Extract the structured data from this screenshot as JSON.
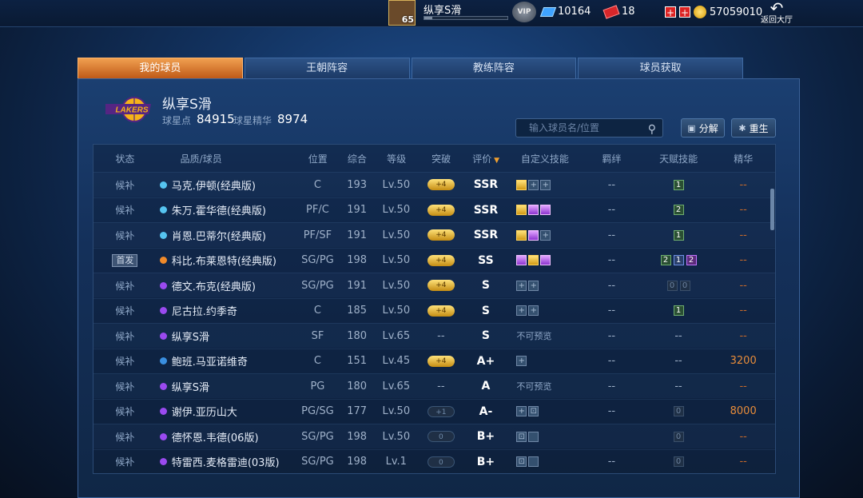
{
  "topbar": {
    "level": "65",
    "username": "纵享S滑",
    "xp_fraction": 0.1,
    "vip_label": "VIP",
    "diamonds": "10164",
    "tickets": "18",
    "coins": "57059010",
    "back_label": "返回大厅"
  },
  "tabs": [
    {
      "label": "我的球员",
      "active": true
    },
    {
      "label": "王朝阵容",
      "active": false
    },
    {
      "label": "教练阵容",
      "active": false
    },
    {
      "label": "球员获取",
      "active": false
    }
  ],
  "team": {
    "name": "纵享S滑",
    "star_points_label": "球星点",
    "star_points": "84915",
    "essence_label": "球星精华",
    "essence": "8974",
    "logo_text": "LAKERS"
  },
  "search": {
    "placeholder": "输入球员名/位置"
  },
  "buttons": {
    "decompose": "分解",
    "rebirth": "重生"
  },
  "columns": [
    "状态",
    "品质/球员",
    "位置",
    "综合",
    "等级",
    "突破",
    "评价",
    "自定义技能",
    "羁绊",
    "天赋技能",
    "精华"
  ],
  "rows": [
    {
      "status": "候补",
      "starter": false,
      "dot": "#56c4f0",
      "name": "马克.伊顿(经典版)",
      "pos": "C",
      "ovr": "193",
      "lvl": "Lv.50",
      "brk": "+4",
      "brk_style": "gold",
      "grade": "SSR",
      "skills": [
        "gold",
        "plus",
        "plus"
      ],
      "skill_text": "",
      "bond": "--",
      "talents": [
        {
          "t": "1",
          "c": ""
        }
      ],
      "ess": "--"
    },
    {
      "status": "候补",
      "starter": false,
      "dot": "#56c4f0",
      "name": "朱万.霍华德(经典版)",
      "pos": "PF/C",
      "ovr": "191",
      "lvl": "Lv.50",
      "brk": "+4",
      "brk_style": "gold",
      "grade": "SSR",
      "skills": [
        "gold",
        "purple",
        "purple"
      ],
      "skill_text": "",
      "bond": "--",
      "talents": [
        {
          "t": "2",
          "c": ""
        }
      ],
      "ess": "--"
    },
    {
      "status": "候补",
      "starter": false,
      "dot": "#56c4f0",
      "name": "肖恩.巴蒂尔(经典版)",
      "pos": "PF/SF",
      "ovr": "191",
      "lvl": "Lv.50",
      "brk": "+4",
      "brk_style": "gold",
      "grade": "SSR",
      "skills": [
        "gold",
        "purple",
        "plus"
      ],
      "skill_text": "",
      "bond": "--",
      "talents": [
        {
          "t": "1",
          "c": ""
        }
      ],
      "ess": "--"
    },
    {
      "status": "首发",
      "starter": true,
      "dot": "#f08a2a",
      "name": "科比.布莱恩特(经典版)",
      "pos": "SG/PG",
      "ovr": "198",
      "lvl": "Lv.50",
      "brk": "+4",
      "brk_style": "gold",
      "grade": "SS",
      "skills": [
        "purple",
        "gold",
        "purple"
      ],
      "skill_text": "",
      "bond": "--",
      "talents": [
        {
          "t": "2",
          "c": ""
        },
        {
          "t": "1",
          "c": "blue"
        },
        {
          "t": "2",
          "c": "purple"
        }
      ],
      "ess": "--"
    },
    {
      "status": "候补",
      "starter": false,
      "dot": "#9a4af0",
      "name": "德文.布克(经典版)",
      "pos": "SG/PG",
      "ovr": "191",
      "lvl": "Lv.50",
      "brk": "+4",
      "brk_style": "gold",
      "grade": "S",
      "skills": [
        "plus",
        "plus"
      ],
      "skill_text": "",
      "bond": "--",
      "talents": [
        {
          "t": "0",
          "c": "empty"
        },
        {
          "t": "0",
          "c": "empty"
        }
      ],
      "ess": "--"
    },
    {
      "status": "候补",
      "starter": false,
      "dot": "#9a4af0",
      "name": "尼古拉.约季奇",
      "pos": "C",
      "ovr": "185",
      "lvl": "Lv.50",
      "brk": "+4",
      "brk_style": "gold",
      "grade": "S",
      "skills": [
        "plus",
        "plus"
      ],
      "skill_text": "",
      "bond": "--",
      "talents": [
        {
          "t": "1",
          "c": ""
        }
      ],
      "ess": "--"
    },
    {
      "status": "候补",
      "starter": false,
      "dot": "#9a4af0",
      "name": "纵享S滑",
      "pos": "SF",
      "ovr": "180",
      "lvl": "Lv.65",
      "brk": "--",
      "brk_style": "none",
      "grade": "S",
      "skills": [],
      "skill_text": "不可预览",
      "bond": "--",
      "talents": [
        {
          "t": "--",
          "c": "text"
        }
      ],
      "ess": "--"
    },
    {
      "status": "候补",
      "starter": false,
      "dot": "#3a8fe0",
      "name": "鲍班.马亚诺维奇",
      "pos": "C",
      "ovr": "151",
      "lvl": "Lv.45",
      "brk": "+4",
      "brk_style": "gold",
      "grade": "A+",
      "skills": [
        "plus"
      ],
      "skill_text": "",
      "bond": "--",
      "talents": [
        {
          "t": "--",
          "c": "text"
        }
      ],
      "ess": "3200"
    },
    {
      "status": "候补",
      "starter": false,
      "dot": "#9a4af0",
      "name": "纵享S滑",
      "pos": "PG",
      "ovr": "180",
      "lvl": "Lv.65",
      "brk": "--",
      "brk_style": "none",
      "grade": "A",
      "skills": [],
      "skill_text": "不可预览",
      "bond": "--",
      "talents": [
        {
          "t": "--",
          "c": "text"
        }
      ],
      "ess": "--"
    },
    {
      "status": "候补",
      "starter": false,
      "dot": "#9a4af0",
      "name": "谢伊.亚历山大",
      "pos": "PG/SG",
      "ovr": "177",
      "lvl": "Lv.50",
      "brk": "+1",
      "brk_style": "dark",
      "grade": "A-",
      "skills": [
        "plus",
        "lock"
      ],
      "skill_text": "",
      "bond": "--",
      "talents": [
        {
          "t": "0",
          "c": "empty"
        }
      ],
      "ess": "8000"
    },
    {
      "status": "候补",
      "starter": false,
      "dot": "#9a4af0",
      "name": "德怀恩.韦德(06版)",
      "pos": "SG/PG",
      "ovr": "198",
      "lvl": "Lv.50",
      "brk": "0",
      "brk_style": "dark",
      "grade": "B+",
      "skills": [
        "lock",
        "blank"
      ],
      "skill_text": "",
      "bond": "",
      "talents": [
        {
          "t": "0",
          "c": "empty"
        }
      ],
      "ess": "--"
    },
    {
      "status": "候补",
      "starter": false,
      "dot": "#9a4af0",
      "name": "特雷西.麦格雷迪(03版)",
      "pos": "SG/PG",
      "ovr": "198",
      "lvl": "Lv.1",
      "brk": "0",
      "brk_style": "dark",
      "grade": "B+",
      "skills": [
        "lock",
        "blank"
      ],
      "skill_text": "",
      "bond": "--",
      "talents": [
        {
          "t": "0",
          "c": "empty"
        }
      ],
      "ess": "--"
    }
  ]
}
